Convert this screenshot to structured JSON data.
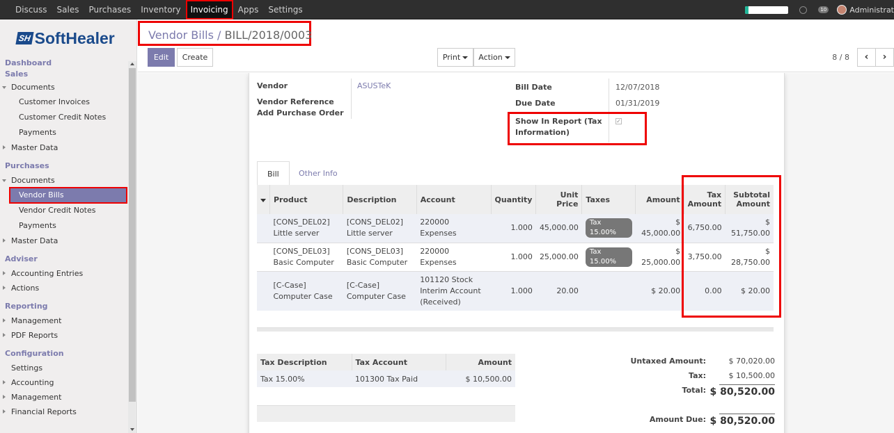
{
  "topbar": {
    "menu": [
      "Discuss",
      "Sales",
      "Purchases",
      "Inventory",
      "Invoicing",
      "Apps",
      "Settings"
    ],
    "active_index": 4,
    "progress": 0.07,
    "chat_count": "10",
    "user": "Administrat"
  },
  "sidebar": {
    "logo_mark": "SH",
    "logo_text": "SoftHealer",
    "items": [
      {
        "type": "sec",
        "label": "Dashboard"
      },
      {
        "type": "sec",
        "label": "Sales"
      },
      {
        "type": "grp",
        "open": true,
        "label": "Documents"
      },
      {
        "type": "sub",
        "label": "Customer Invoices"
      },
      {
        "type": "sub",
        "label": "Customer Credit Notes"
      },
      {
        "type": "sub",
        "label": "Payments"
      },
      {
        "type": "grp",
        "label": "Master Data"
      },
      {
        "type": "sec",
        "label": "Purchases"
      },
      {
        "type": "grp",
        "open": true,
        "label": "Documents"
      },
      {
        "type": "sub",
        "label": "Vendor Bills",
        "active": true
      },
      {
        "type": "sub",
        "label": "Vendor Credit Notes"
      },
      {
        "type": "sub",
        "label": "Payments"
      },
      {
        "type": "grp",
        "label": "Master Data"
      },
      {
        "type": "sec",
        "label": "Adviser"
      },
      {
        "type": "grp",
        "label": "Accounting Entries"
      },
      {
        "type": "grp",
        "label": "Actions"
      },
      {
        "type": "sec",
        "label": "Reporting"
      },
      {
        "type": "grp",
        "label": "Management"
      },
      {
        "type": "grp",
        "label": "PDF Reports"
      },
      {
        "type": "sec",
        "label": "Configuration"
      },
      {
        "type": "plain",
        "label": "Settings"
      },
      {
        "type": "grp",
        "label": "Accounting"
      },
      {
        "type": "grp",
        "label": "Management"
      },
      {
        "type": "grp",
        "label": "Financial Reports"
      }
    ]
  },
  "control_panel": {
    "breadcrumb_parent": "Vendor Bills",
    "breadcrumb_sep": "/",
    "breadcrumb_current": "BILL/2018/0003",
    "edit_label": "Edit",
    "create_label": "Create",
    "print_label": "Print",
    "action_label": "Action",
    "pager": "8 / 8",
    "prev_icon": "‹",
    "next_icon": "›"
  },
  "form": {
    "vendor_label": "Vendor",
    "vendor_value": "ASUSTeK",
    "vendor_ref_label": "Vendor Reference",
    "add_po_label": "Add Purchase Order",
    "bill_date_label": "Bill Date",
    "bill_date_value": "12/07/2018",
    "due_date_label": "Due Date",
    "due_date_value": "01/31/2019",
    "show_report_label": "Show In Report (Tax Information)",
    "show_report_checked": true
  },
  "tabs": [
    "Bill",
    "Other Info"
  ],
  "lines": {
    "headers": [
      "Product",
      "Description",
      "Account",
      "Quantity",
      "Unit Price",
      "Taxes",
      "Amount",
      "Tax Amount",
      "Subtotal Amount"
    ],
    "rows": [
      {
        "product": "[CONS_DEL02] Little server",
        "description": "[CONS_DEL02] Little server",
        "account": "220000 Expenses",
        "quantity": "1.000",
        "unit_price": "45,000.00",
        "taxes": "Tax 15.00%",
        "amount": "$ 45,000.00",
        "tax_amount": "6,750.00",
        "subtotal": "$ 51,750.00"
      },
      {
        "product": "[CONS_DEL03] Basic Computer",
        "description": "[CONS_DEL03] Basic Computer",
        "account": "220000 Expenses",
        "quantity": "1.000",
        "unit_price": "25,000.00",
        "taxes": "Tax 15.00%",
        "amount": "$ 25,000.00",
        "tax_amount": "3,750.00",
        "subtotal": "$ 28,750.00"
      },
      {
        "product": "[C-Case] Computer Case",
        "description": "[C-Case] Computer Case",
        "account": "101120 Stock Interim Account (Received)",
        "quantity": "1.000",
        "unit_price": "20.00",
        "taxes": "",
        "amount": "$ 20.00",
        "tax_amount": "0.00",
        "subtotal": "$ 20.00"
      }
    ]
  },
  "tax_table": {
    "headers": [
      "Tax Description",
      "Tax Account",
      "Amount"
    ],
    "rows": [
      {
        "description": "Tax 15.00%",
        "account": "101300 Tax Paid",
        "amount": "$ 10,500.00"
      }
    ]
  },
  "totals": {
    "untaxed_label": "Untaxed Amount:",
    "untaxed_value": "$ 70,020.00",
    "tax_label": "Tax:",
    "tax_value": "$ 10,500.00",
    "total_label": "Total:",
    "total_value": "$ 80,520.00",
    "due_label": "Amount Due:",
    "due_value": "$ 80,520.00"
  }
}
